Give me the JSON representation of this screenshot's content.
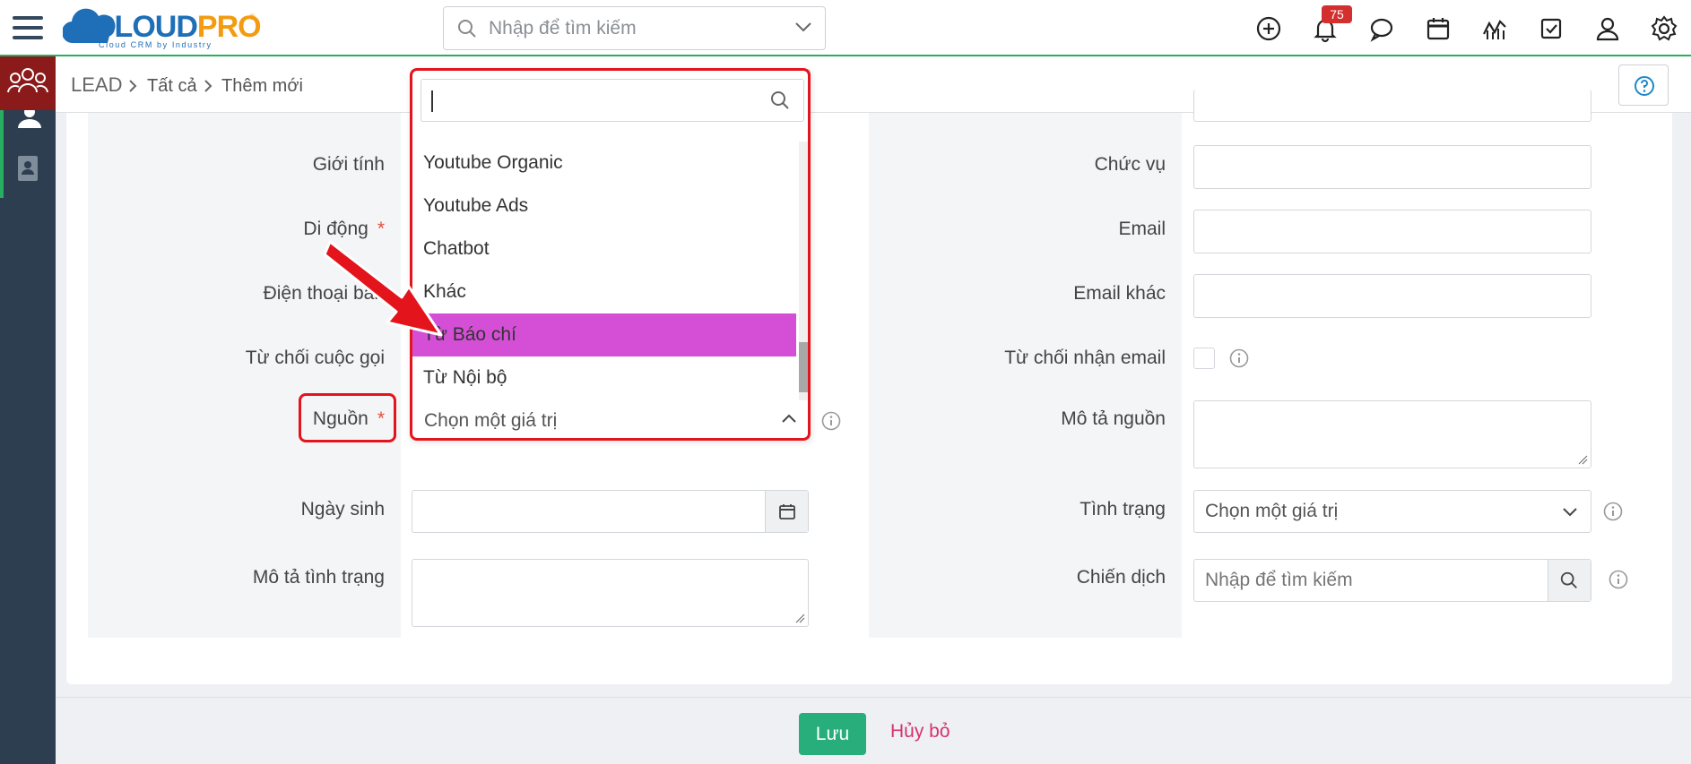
{
  "app": {
    "logo_text_a": "CLOUD",
    "logo_text_b": "PRO",
    "logo_tagline": "Cloud CRM by Industry",
    "logo_reg": "®"
  },
  "topbar": {
    "search_placeholder": "Nhập để tìm kiếm",
    "notification_count": "75",
    "icons": [
      "plus-circle-icon",
      "bell-icon",
      "chat-icon",
      "calendar-icon",
      "chart-icon",
      "checkbox-icon",
      "user-icon",
      "gear-icon"
    ]
  },
  "sidebar": {
    "items": [
      "lead-group-icon",
      "contact-person-icon",
      "contact-card-icon"
    ]
  },
  "breadcrumb": {
    "module": "LEAD",
    "level1": "Tất cả",
    "level2": "Thêm mới"
  },
  "form": {
    "left": {
      "gender_label": "Giới tính",
      "mobile_label": "Di động",
      "phone_label": "Điện thoại bàn",
      "call_refuse_label": "Từ chối cuộc gọi",
      "source_label": "Nguồn",
      "birthday_label": "Ngày sinh",
      "status_desc_label": "Mô tả tình trạng"
    },
    "right": {
      "position_label": "Chức vụ",
      "email_label": "Email",
      "email_other_label": "Email khác",
      "email_refuse_label": "Từ chối nhận email",
      "source_desc_label": "Mô tả nguồn",
      "status_label": "Tình trạng",
      "status_value": "Chọn một giá trị",
      "campaign_label": "Chiến dịch",
      "campaign_placeholder": "Nhập để tìm kiếm"
    },
    "required_mark": "*"
  },
  "dropdown": {
    "search_value": "",
    "options": [
      "Youtube Organic",
      "Youtube Ads",
      "Chatbot",
      "Khác",
      "Từ Báo chí",
      "Từ Nội bộ"
    ],
    "highlighted": "Từ Báo chí",
    "selected_placeholder": "Chọn một giá trị"
  },
  "footer": {
    "save_label": "Lưu",
    "cancel_label": "Hủy bỏ"
  },
  "colors": {
    "accent_green": "#27ae7a",
    "highlight": "#d44fd6",
    "annotation_red": "#e3141b",
    "sidebar": "#2c3e50"
  }
}
